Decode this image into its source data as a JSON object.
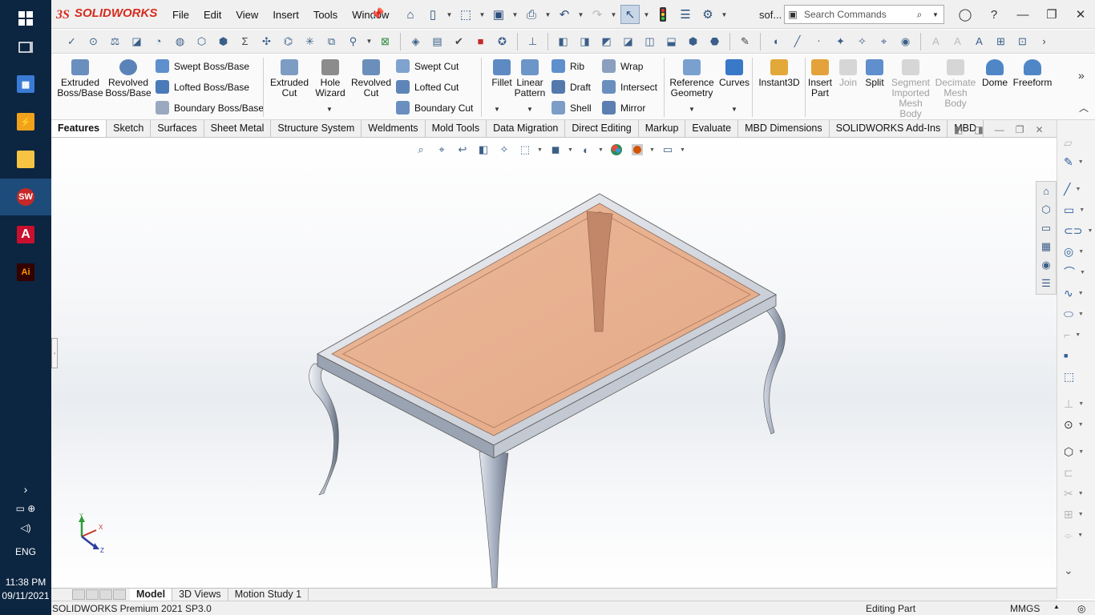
{
  "taskbar": {
    "apps": [
      {
        "name": "windows-start",
        "glyph": "⊞"
      },
      {
        "name": "task-view",
        "glyph": "❐"
      },
      {
        "name": "calculator",
        "glyph": "▦"
      },
      {
        "name": "app-lightning",
        "glyph": "⚡"
      },
      {
        "name": "file-explorer",
        "glyph": "▬"
      },
      {
        "name": "solidworks",
        "glyph": "SW"
      },
      {
        "name": "autocad",
        "glyph": "A"
      },
      {
        "name": "illustrator",
        "glyph": "Ai"
      }
    ],
    "language": "ENG",
    "time": "11:38 PM",
    "date": "09/11/2021"
  },
  "menubar": {
    "logo": "SOLIDWORKS",
    "menus": [
      "File",
      "Edit",
      "View",
      "Insert",
      "Tools",
      "Window"
    ],
    "doc_name": "sof...",
    "search_placeholder": "Search Commands"
  },
  "ribbon": {
    "big_buttons": [
      {
        "id": "extruded-boss",
        "label1": "Extruded",
        "label2": "Boss/Base"
      },
      {
        "id": "revolved-boss",
        "label1": "Revolved",
        "label2": "Boss/Base"
      },
      {
        "id": "extruded-cut",
        "label1": "Extruded",
        "label2": "Cut"
      },
      {
        "id": "hole-wizard",
        "label1": "Hole",
        "label2": "Wizard"
      },
      {
        "id": "revolved-cut",
        "label1": "Revolved",
        "label2": "Cut"
      },
      {
        "id": "fillet",
        "label1": "Fillet",
        "label2": ""
      },
      {
        "id": "linear-pattern",
        "label1": "Linear",
        "label2": "Pattern"
      },
      {
        "id": "reference-geometry",
        "label1": "Reference",
        "label2": "Geometry"
      },
      {
        "id": "curves",
        "label1": "Curves",
        "label2": ""
      },
      {
        "id": "instant3d",
        "label1": "Instant3D",
        "label2": ""
      },
      {
        "id": "insert-part",
        "label1": "Insert",
        "label2": "Part"
      },
      {
        "id": "join",
        "label1": "Join",
        "label2": ""
      },
      {
        "id": "split",
        "label1": "Split",
        "label2": ""
      },
      {
        "id": "segment-mesh",
        "label1": "Segment",
        "label2": "Imported",
        "label3": "Mesh",
        "label4": "Body"
      },
      {
        "id": "decimate-mesh",
        "label1": "Decimate",
        "label2": "Mesh",
        "label3": "Body"
      },
      {
        "id": "dome",
        "label1": "Dome",
        "label2": ""
      },
      {
        "id": "freeform",
        "label1": "Freeform",
        "label2": ""
      }
    ],
    "small_buttons": [
      "Swept Boss/Base",
      "Lofted Boss/Base",
      "Boundary Boss/Base",
      "Swept Cut",
      "Lofted Cut",
      "Boundary Cut",
      "Rib",
      "Draft",
      "Shell",
      "Wrap",
      "Intersect",
      "Mirror"
    ]
  },
  "tabs": [
    "Features",
    "Sketch",
    "Surfaces",
    "Sheet Metal",
    "Structure System",
    "Weldments",
    "Mold Tools",
    "Data Migration",
    "Direct Editing",
    "Markup",
    "Evaluate",
    "MBD Dimensions",
    "SOLIDWORKS Add-Ins",
    "MBD"
  ],
  "active_tab": "Features",
  "model": {
    "glass_color": "#e9b08e",
    "frame_color": "#d8dde6",
    "leg_color": "#b9c1d0",
    "triad": {
      "x": "X",
      "y": "Y",
      "z": "Z"
    }
  },
  "bottom_tabs": [
    "Model",
    "3D Views",
    "Motion Study 1"
  ],
  "status": {
    "product": "SOLIDWORKS Premium 2021 SP3.0",
    "mode": "Editing Part",
    "units": "MMGS"
  }
}
